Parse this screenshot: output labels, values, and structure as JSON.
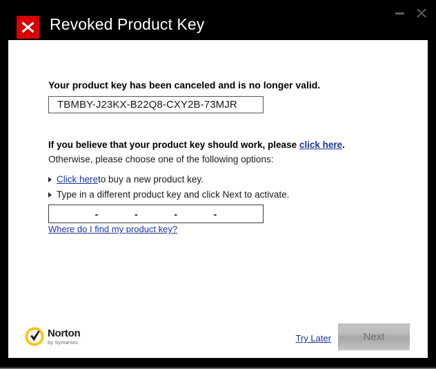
{
  "window": {
    "title": "Revoked Product Key",
    "title_icon": "error-x-icon",
    "minimize_label": "Minimize",
    "close_label": "Close",
    "colors": {
      "titlebar_bg": "#000000",
      "content_bg": "#ffffff",
      "error_red": "#d90000",
      "link_blue": "#1a33a8",
      "norton_yellow": "#ffc20e",
      "disabled_button_text": "#6f6f6f"
    }
  },
  "main": {
    "headline": "Your product key has been canceled and is no longer valid.",
    "revoked_key": "TBMBY-J23KX-B22Q8-CXY2B-73MJR",
    "believe_prefix": "If you believe that your product key should work, please",
    "believe_link": "click here",
    "believe_suffix": ".",
    "otherwise": "Otherwise, please choose one of the following options:",
    "options": [
      {
        "bullet": "triangle-right-icon",
        "link": "Click here",
        "text": " to buy a new product key."
      },
      {
        "bullet": "triangle-right-icon",
        "link": "",
        "text": "Type in a different product key and click Next to activate."
      }
    ],
    "key_entry": {
      "segments": [
        "",
        "",
        "",
        "",
        ""
      ],
      "separator": "-",
      "placeholder": ""
    },
    "find_key_link": "Where do I find my product key?"
  },
  "footer": {
    "logo_name": "Norton",
    "logo_sub": "by Symantec",
    "logo_mark": "check-shield-icon",
    "try_later": "Try Later",
    "next_label": "Next"
  }
}
